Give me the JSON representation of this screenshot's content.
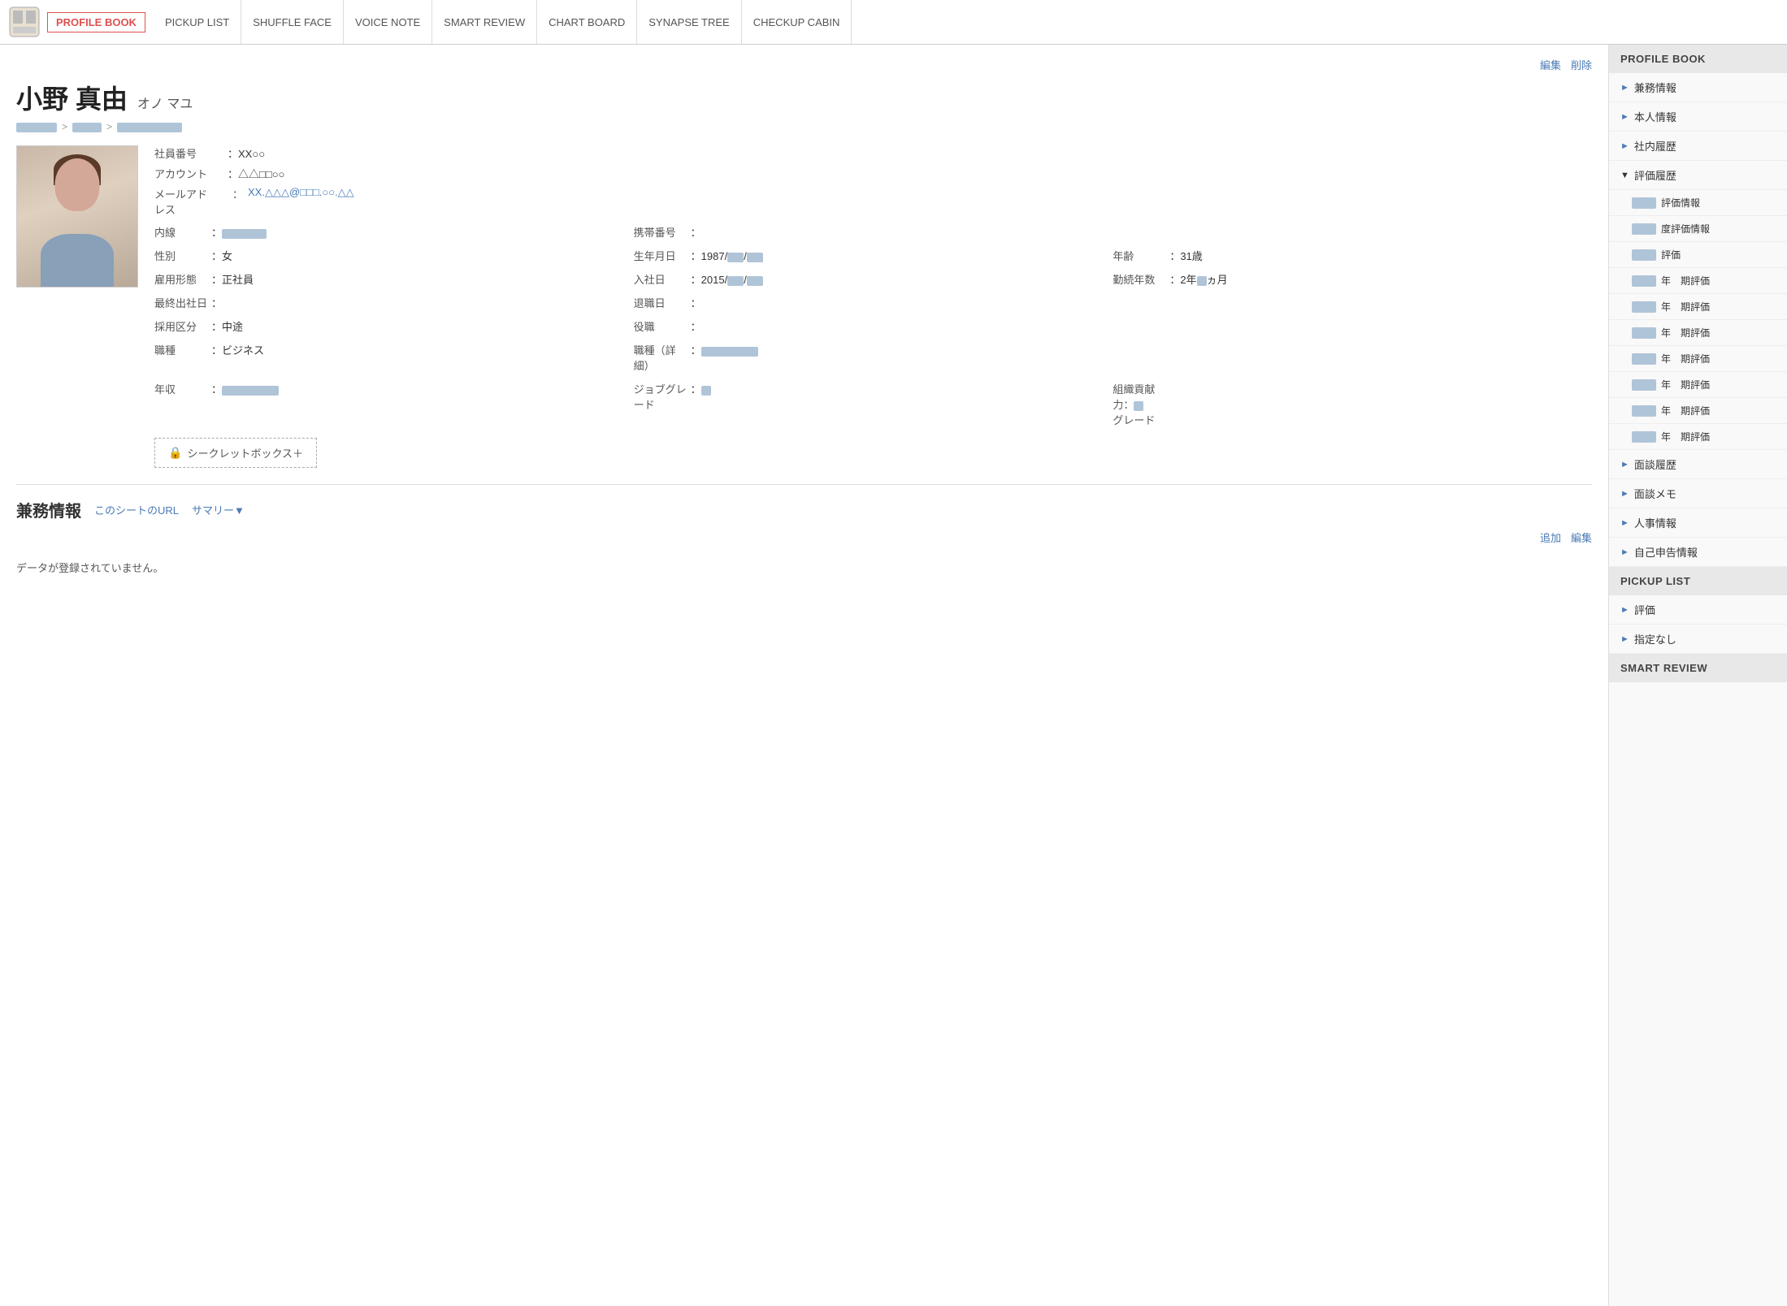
{
  "nav": {
    "items": [
      {
        "label": "PROFILE BOOK",
        "active": true
      },
      {
        "label": "PICKUP LIST"
      },
      {
        "label": "SHUFFLE FACE"
      },
      {
        "label": "VOICE NOTE"
      },
      {
        "label": "SMART REVIEW"
      },
      {
        "label": "CHART BOARD"
      },
      {
        "label": "SYNAPSE TREE"
      },
      {
        "label": "CHECKUP CABIN"
      }
    ]
  },
  "profile": {
    "name_kanji": "小野 真由",
    "name_kana": "オノ マユ",
    "edit_label": "編集",
    "delete_label": "削除",
    "breadcrumb": [
      "██████",
      "████",
      "████████████"
    ],
    "employee_number_label": "社員番号",
    "employee_number": "：XX○○",
    "account_label": "アカウント",
    "account": "：△△□□○○",
    "email_label": "メールアド",
    "email_sublabel": "レス",
    "email": "XX.△△△@□□□.○○.△△",
    "naisen_label": "内線",
    "naisen": "：██████",
    "keitai_label": "携帯番号",
    "keitai": "：",
    "gender_label": "性別",
    "gender": "：女",
    "birthday_label": "生年月日",
    "birthday": "：1987/██/██",
    "age_label": "年齢",
    "age": "：31歳",
    "koyou_label": "雇用形態",
    "koyou": "：正社員",
    "nyusha_label": "入社日",
    "nyusha": "：2015/██/██",
    "kinzoku_label": "勤続年数",
    "kinzoku": "：2年█ヵ月",
    "saishuu_label": "最終出社日",
    "saishuu": "：",
    "taishoku_label": "退職日",
    "taishoku": "：",
    "saiyo_label": "採用区分",
    "saiyo": "：中途",
    "yakushoku_label": "役職",
    "yakushoku": "：",
    "shokushu_label": "職種",
    "shokushu": "：ビジネス",
    "shokushu_detail_label": "職種（詳細）",
    "shokushu_detail": "：██████████",
    "nenshu_label": "年収",
    "nenshu": "：██████████",
    "jobgrade_label": "ジョブグレ\nード",
    "jobgrade": "：█",
    "soshiki_label": "組織貢献力：█\nグレード",
    "secret_box_label": "シークレットボックス＋"
  },
  "兼務情報": {
    "section_title": "兼務情報",
    "url_link": "このシートのURL",
    "summary_link": "サマリー▼",
    "add_label": "追加",
    "edit_label": "編集",
    "empty_message": "データが登録されていません。"
  },
  "sidebar": {
    "sections": [
      {
        "title": "PROFILE BOOK",
        "items": [
          {
            "label": "兼務情報",
            "arrow": "►",
            "sub": false
          },
          {
            "label": "本人情報",
            "arrow": "►",
            "sub": false
          },
          {
            "label": "社内履歴",
            "arrow": "►",
            "sub": false
          },
          {
            "label": "評価履歴",
            "arrow": "▼",
            "open": true,
            "sub": false
          },
          {
            "label": "評価情報",
            "badge": true,
            "sub": true
          },
          {
            "label": "度評価情報",
            "badge": true,
            "sub": true
          },
          {
            "label": "評価",
            "badge": true,
            "sub": true
          },
          {
            "label": "年　期評価",
            "badge": true,
            "sub": true
          },
          {
            "label": "年　期評価",
            "badge": true,
            "sub": true
          },
          {
            "label": "年　期評価",
            "badge": true,
            "sub": true
          },
          {
            "label": "年　期評価",
            "badge": true,
            "sub": true
          },
          {
            "label": "年　期評価",
            "badge": true,
            "sub": true
          },
          {
            "label": "年　期評価",
            "badge": true,
            "sub": true
          },
          {
            "label": "年　期評価",
            "badge": true,
            "sub": true
          },
          {
            "label": "面談履歴",
            "arrow": "►",
            "sub": false
          },
          {
            "label": "面談メモ",
            "arrow": "►",
            "sub": false
          },
          {
            "label": "人事情報",
            "arrow": "►",
            "sub": false
          },
          {
            "label": "自己申告情報",
            "arrow": "►",
            "sub": false
          }
        ]
      },
      {
        "title": "PICKUP LIST",
        "items": [
          {
            "label": "評価",
            "arrow": "►",
            "sub": false
          },
          {
            "label": "指定なし",
            "arrow": "►",
            "sub": false
          }
        ]
      },
      {
        "title": "SMART REVIEW",
        "items": []
      }
    ]
  }
}
